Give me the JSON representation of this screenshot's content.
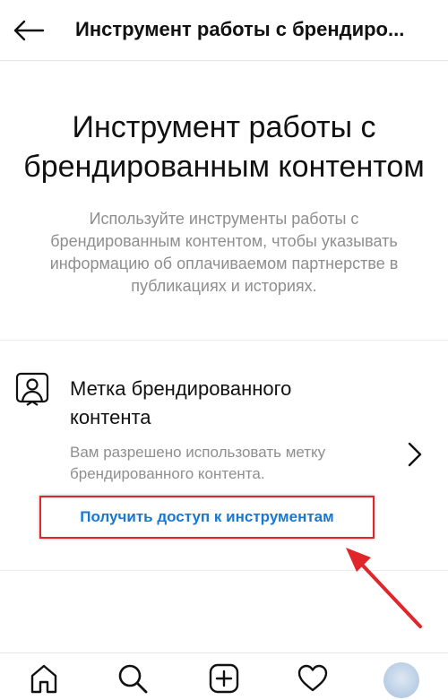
{
  "header": {
    "title": "Инструмент работы с брендиро...",
    "back_icon": "back-arrow-icon"
  },
  "hero": {
    "title": "Инструмент работы с брендированным контентом",
    "description": "Используйте инструменты работы с брендированным контентом, чтобы указывать информацию об оплачиваемом партнерстве в публикациях и историях."
  },
  "branded_tag": {
    "icon": "person-badge-icon",
    "title": "Метка брендированного контента",
    "subtitle": "Вам разрешено использовать метку брендированного контента.",
    "access_link": "Получить доступ к инструментам"
  },
  "annotation": {
    "box_color": "#e1262b",
    "arrow_color": "#e1262b"
  },
  "bottom_nav": {
    "items": [
      "home-icon",
      "search-icon",
      "new-post-icon",
      "heart-icon",
      "profile-avatar"
    ]
  },
  "colors": {
    "link_blue": "#1877d2",
    "secondary_text": "#8e8e8e"
  }
}
